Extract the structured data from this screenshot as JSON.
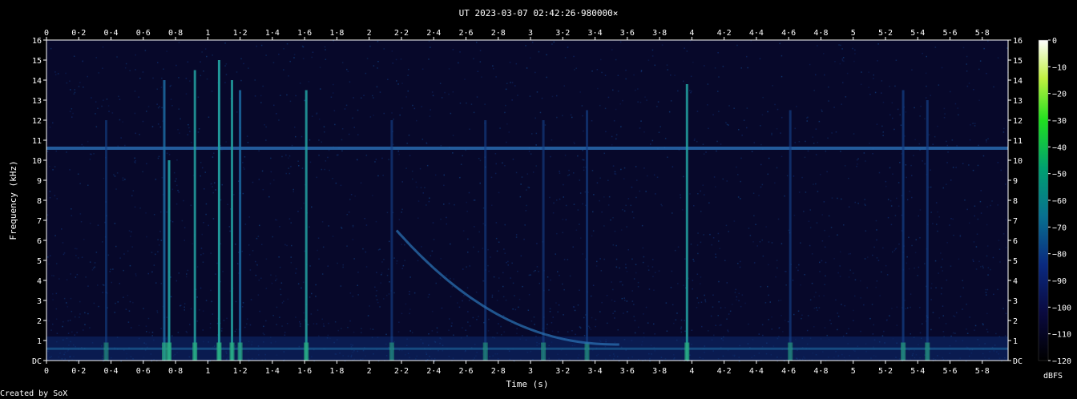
{
  "chart_data": {
    "type": "heatmap",
    "title": "UT 2023-03-07 02:42:26·980000×",
    "xlabel": "Time (s)",
    "ylabel": "Frequency (kHz)",
    "xlim": [
      0,
      5.96
    ],
    "ylim": [
      0,
      16
    ],
    "x_ticks": [
      "0",
      "0·2",
      "0·4",
      "0·6",
      "0·8",
      "1",
      "1·2",
      "1·4",
      "1·6",
      "1·8",
      "2",
      "2·2",
      "2·4",
      "2·6",
      "2·8",
      "3",
      "3·2",
      "3·4",
      "3·6",
      "3·8",
      "4",
      "4·2",
      "4·4",
      "4·6",
      "4·8",
      "5",
      "5·2",
      "5·4",
      "5·6",
      "5·8"
    ],
    "y_ticks": [
      "DC",
      "1",
      "2",
      "3",
      "4",
      "5",
      "6",
      "7",
      "8",
      "9",
      "10",
      "11",
      "12",
      "13",
      "14",
      "15",
      "16"
    ],
    "colorbar": {
      "label": "dBFS",
      "range": [
        -120,
        0
      ],
      "ticks": [
        "0",
        "−10",
        "−20",
        "−30",
        "−40",
        "−50",
        "−60",
        "−70",
        "−80",
        "−90",
        "−100",
        "−110",
        "−120"
      ]
    },
    "horizontal_tone_khz": 10.6,
    "transients": [
      {
        "t": 0.73,
        "f_top": 14,
        "strength": 0.7
      },
      {
        "t": 0.76,
        "f_top": 10,
        "strength": 0.9
      },
      {
        "t": 0.92,
        "f_top": 14.5,
        "strength": 0.8
      },
      {
        "t": 1.07,
        "f_top": 15,
        "strength": 1.0
      },
      {
        "t": 1.15,
        "f_top": 14,
        "strength": 0.8
      },
      {
        "t": 1.2,
        "f_top": 13.5,
        "strength": 0.7
      },
      {
        "t": 1.61,
        "f_top": 13.5,
        "strength": 0.8
      },
      {
        "t": 3.97,
        "f_top": 13.8,
        "strength": 0.8
      },
      {
        "t": 5.31,
        "f_top": 13.5,
        "strength": 0.5
      },
      {
        "t": 5.46,
        "f_top": 13,
        "strength": 0.45
      },
      {
        "t": 2.14,
        "f_top": 12,
        "strength": 0.3
      },
      {
        "t": 3.35,
        "f_top": 12.5,
        "strength": 0.35
      },
      {
        "t": 4.61,
        "f_top": 12.5,
        "strength": 0.35
      },
      {
        "t": 0.37,
        "f_top": 12.0,
        "strength": 0.25
      },
      {
        "t": 2.72,
        "f_top": 12.0,
        "strength": 0.3
      },
      {
        "t": 3.08,
        "f_top": 12.0,
        "strength": 0.3
      }
    ],
    "whistler": {
      "t_start": 2.17,
      "f_start": 6.5,
      "t_end": 3.55,
      "f_end": 0.8
    }
  },
  "footer": {
    "credit": "Created by SoX"
  }
}
